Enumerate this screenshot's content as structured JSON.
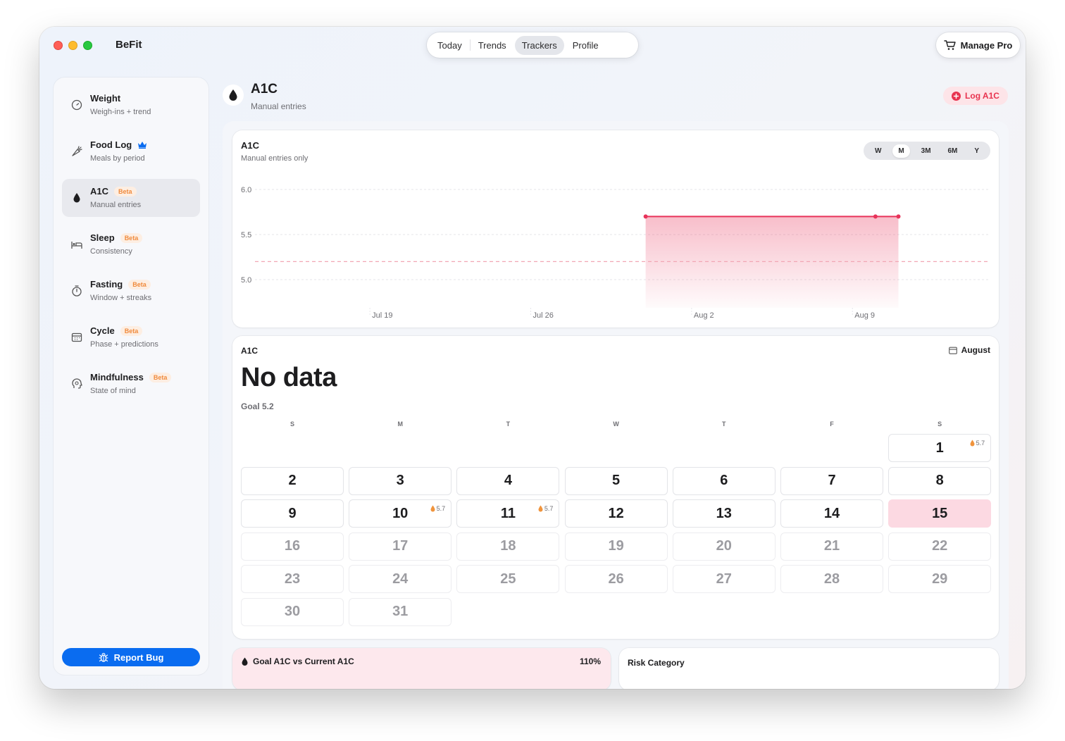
{
  "app": {
    "name": "BeFit"
  },
  "tabs": [
    {
      "label": "Today",
      "active": false
    },
    {
      "label": "Trends",
      "active": false
    },
    {
      "label": "Trackers",
      "active": true
    },
    {
      "label": "Profile",
      "active": false
    }
  ],
  "manage_pro": {
    "label": "Manage Pro",
    "icon": "cart-icon"
  },
  "sidebar": {
    "items": [
      {
        "title": "Weight",
        "sub": "Weigh-ins + trend",
        "icon": "scale-icon",
        "badge": "",
        "active": false
      },
      {
        "title": "Food Log",
        "sub": "Meals by period",
        "icon": "carrot-icon",
        "badge": "",
        "crown": true,
        "active": false
      },
      {
        "title": "A1C",
        "sub": "Manual entries",
        "icon": "drop-icon",
        "badge": "Beta",
        "active": true
      },
      {
        "title": "Sleep",
        "sub": "Consistency",
        "icon": "bed-icon",
        "badge": "Beta",
        "active": false
      },
      {
        "title": "Fasting",
        "sub": "Window + streaks",
        "icon": "timer-icon",
        "badge": "Beta",
        "active": false
      },
      {
        "title": "Cycle",
        "sub": "Phase + predictions",
        "icon": "calendar-icon",
        "badge": "Beta",
        "active": false
      },
      {
        "title": "Mindfulness",
        "sub": "State of mind",
        "icon": "head-icon",
        "badge": "Beta",
        "active": false
      }
    ],
    "report_bug": "Report Bug"
  },
  "header": {
    "title": "A1C",
    "sub": "Manual entries",
    "log_button": "Log A1C"
  },
  "chart": {
    "title": "A1C",
    "sub": "Manual entries only",
    "ranges": [
      {
        "label": "W",
        "active": false
      },
      {
        "label": "M",
        "active": true
      },
      {
        "label": "3M",
        "active": false
      },
      {
        "label": "6M",
        "active": false
      },
      {
        "label": "Y",
        "active": false
      }
    ]
  },
  "chart_data": {
    "type": "area",
    "title": "A1C",
    "subtitle": "Manual entries only",
    "xlabel": "",
    "ylabel": "",
    "x_ticks": [
      "Jul 19",
      "Jul 26",
      "Aug 2",
      "Aug 9"
    ],
    "y_ticks": [
      "6.0",
      "5.5",
      "5.0"
    ],
    "ylim": [
      4.7,
      6.0
    ],
    "xlim": [
      "2025-07-14",
      "2025-08-15"
    ],
    "goal_line": 5.2,
    "series": [
      {
        "x": [
          "2025-07-31",
          "2025-08-10",
          "2025-08-11"
        ],
        "y": [
          5.7,
          5.7,
          5.7
        ]
      }
    ],
    "colors": {
      "line": "#e8335a",
      "goal": "#f2a7b5"
    },
    "grid": true
  },
  "calendar": {
    "label": "A1C",
    "month": "August",
    "big_value": "No data",
    "goal_text": "Goal 5.2",
    "dow": [
      "S",
      "M",
      "T",
      "W",
      "T",
      "F",
      "S"
    ],
    "first_weekday": 6,
    "days_in_month": 31,
    "today": 15,
    "values": {
      "1": "5.7",
      "10": "5.7",
      "11": "5.7"
    }
  },
  "goal_card": {
    "title": "Goal A1C vs Current A1C",
    "pct": "110%"
  },
  "risk_card": {
    "title": "Risk Category"
  }
}
